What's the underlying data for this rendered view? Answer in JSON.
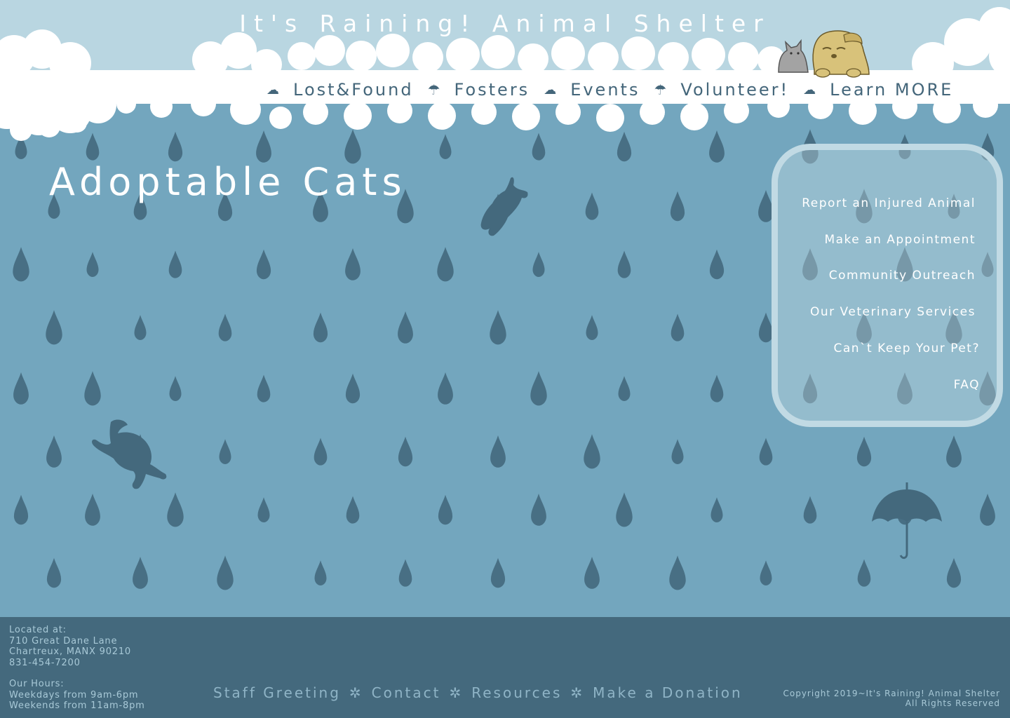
{
  "site": {
    "title": "It's Raining! Animal Shelter"
  },
  "nav": {
    "items": [
      {
        "label": "Lost&Found",
        "icon": "cloud-icon"
      },
      {
        "label": "Fosters",
        "icon": "umbrella-icon"
      },
      {
        "label": "Events",
        "icon": "cloud-icon"
      },
      {
        "label": "Volunteer!",
        "icon": "umbrella-icon"
      },
      {
        "label": "Learn MORE",
        "icon": "cloud-icon"
      }
    ]
  },
  "main": {
    "title": "Adoptable Cats"
  },
  "sidebar": {
    "links": [
      {
        "label": "Report an Injured Animal"
      },
      {
        "label": "Make an Appointment"
      },
      {
        "label": "Community Outreach"
      },
      {
        "label": "Our Veterinary Services"
      },
      {
        "label": "Can`t Keep Your Pet?"
      },
      {
        "label": "FAQ"
      }
    ]
  },
  "footer": {
    "located_label": "Located at:",
    "address_line1": "710 Great Dane Lane",
    "address_line2": "Chartreux, MANX 90210",
    "phone": "831-454-7200",
    "hours_label": "Our Hours:",
    "hours_weekdays": "Weekdays from 9am-6pm",
    "hours_weekends": "Weekends from 11am-8pm",
    "links": [
      {
        "label": "Staff Greeting"
      },
      {
        "label": "Contact"
      },
      {
        "label": "Resources"
      },
      {
        "label": "Make a Donation"
      }
    ],
    "separator": "✲",
    "copyright_line1": "Copyright 2019~It's Raining! Animal Shelter",
    "copyright_line2": "All Rights Reserved"
  },
  "colors": {
    "sky": "#b9d6e1",
    "rain_background": "#73a6be",
    "raindrop": "#44697d",
    "footer": "#44697d",
    "nav_text": "#44667a",
    "cloud": "#ffffff",
    "dog": "#d8c27a"
  }
}
